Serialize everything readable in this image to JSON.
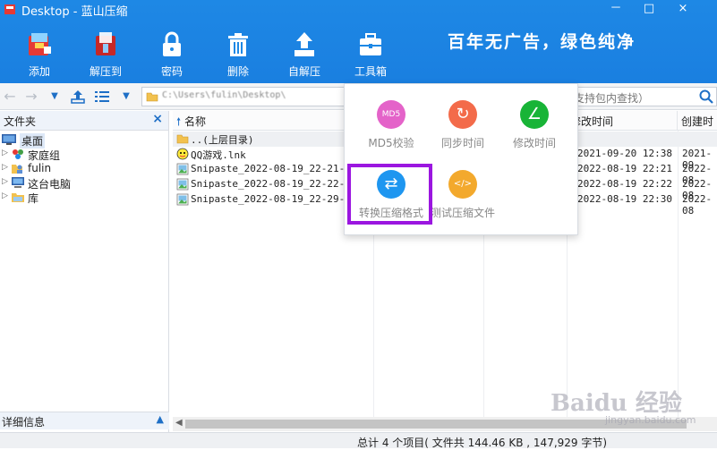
{
  "window": {
    "title": "Desktop - 蓝山压缩",
    "controls": [
      "－",
      "□",
      "×"
    ]
  },
  "slogan": "百年无广告，绿色纯净",
  "toolbar": {
    "items": [
      {
        "label": "添加",
        "icon": "add-archive-icon"
      },
      {
        "label": "解压到",
        "icon": "extract-icon"
      },
      {
        "label": "密码",
        "icon": "lock-icon"
      },
      {
        "label": "删除",
        "icon": "trash-icon"
      },
      {
        "label": "自解压",
        "icon": "self-extract-icon"
      },
      {
        "label": "工具箱",
        "icon": "toolbox-icon"
      }
    ]
  },
  "address": {
    "path": "C:\\Users\\fulin\\Desktop\\",
    "search_placeholder": "支持包内查找）"
  },
  "left_panel": {
    "title": "文件夹",
    "close": "×",
    "tree": [
      {
        "label": "桌面",
        "icon": "desktop-icon",
        "selected": true,
        "arrow": ""
      },
      {
        "label": "家庭组",
        "icon": "homegroup-icon",
        "arrow": "▷"
      },
      {
        "label": "fulin",
        "icon": "user-folder-icon",
        "arrow": "▷"
      },
      {
        "label": "这台电脑",
        "icon": "computer-icon",
        "arrow": "▷"
      },
      {
        "label": "库",
        "icon": "library-icon",
        "arrow": "▷"
      }
    ],
    "detail": "详细信息",
    "detail_toggle": "▲"
  },
  "file_list": {
    "columns": [
      "名称",
      "修改时间",
      "创建时"
    ],
    "rows": [
      {
        "name": "..(上层目录)",
        "modified": "",
        "created": "",
        "icon": "parent-folder-icon"
      },
      {
        "name": "QQ游戏.lnk",
        "modified": "2021-09-20 12:38",
        "created": "2021-09",
        "icon": "shortcut-icon"
      },
      {
        "name": "Snipaste_2022-08-19_22-21-10.",
        "modified": "2022-08-19 22:21",
        "created": "2022-08",
        "icon": "image-file-icon"
      },
      {
        "name": "Snipaste_2022-08-19_22-22-40.",
        "modified": "2022-08-19 22:22",
        "created": "2022-08",
        "icon": "image-file-icon"
      },
      {
        "name": "Snipaste_2022-08-19_22-29-36.",
        "modified": "2022-08-19 22:30",
        "created": "2022-08",
        "icon": "image-file-icon"
      }
    ]
  },
  "toolbox_popup": {
    "items": [
      {
        "label": "MD5校验",
        "glyph": "MD5",
        "color": "#e463c9"
      },
      {
        "label": "同步时间",
        "glyph": "↻",
        "color": "#f36b4a"
      },
      {
        "label": "修改时间",
        "glyph": "∠",
        "color": "#18b437"
      },
      {
        "label": "转换压缩格式",
        "glyph": "⇄",
        "color": "#1e96f0"
      },
      {
        "label": "测试压缩文件",
        "glyph": "</>",
        "color": "#f3a92d"
      }
    ]
  },
  "status": "总计 4 个项目( 文件共 144.46 KB , 147,929 字节)",
  "watermark": {
    "main": "Baidu 经验",
    "sub": "jingyan.baidu.com"
  }
}
